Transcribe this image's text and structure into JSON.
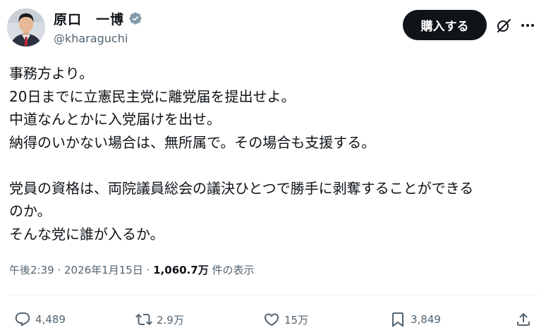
{
  "user": {
    "display_name": "原口　一博",
    "handle": "@kharaguchi",
    "verified": true,
    "verified_color": "#829aab"
  },
  "toolbar": {
    "buy_label": "購入する",
    "grok_icon": "grok-icon",
    "more_icon": "more-icon"
  },
  "post": {
    "lines": [
      "事務方より。",
      "20日までに立憲民主党に離党届を提出せよ。",
      "中道なんとかに入党届けを出せ。",
      "納得のいかない場合は、無所属で。その場合も支援する。",
      "",
      "党員の資格は、両院議員総会の議決ひとつで勝手に剥奪することができる",
      "のか。",
      "そんな党に誰が入るか。"
    ]
  },
  "meta": {
    "time": "午後2:39",
    "separator": " · ",
    "date": "2026年1月15日",
    "views": "1,060.7万",
    "views_label": " 件の表示"
  },
  "actions": {
    "replies": "4,489",
    "reposts": "2.9万",
    "likes": "15万",
    "bookmarks": "3,849"
  },
  "colors": {
    "text": "#0f1419",
    "secondary": "#536471",
    "button_bg": "#0f1419",
    "button_text": "#ffffff"
  }
}
